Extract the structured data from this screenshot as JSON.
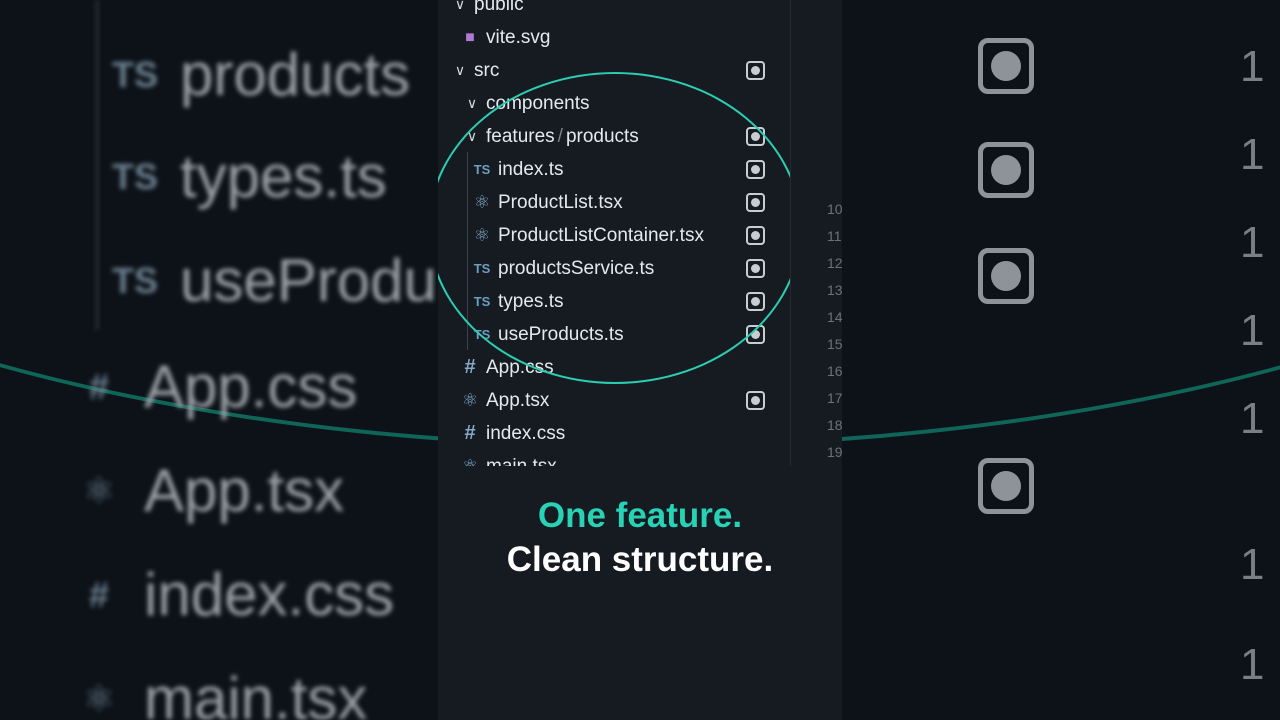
{
  "background": {
    "left_items": [
      {
        "icon": "TS",
        "text": "products"
      },
      {
        "icon": "TS",
        "text": "types.ts"
      },
      {
        "icon": "TS",
        "text": "useProdu"
      },
      {
        "icon": "#",
        "text": "App.css"
      },
      {
        "icon": "⚛",
        "text": "App.tsx"
      },
      {
        "icon": "#",
        "text": "index.css"
      },
      {
        "icon": "⚛",
        "text": "main.tsx"
      }
    ],
    "right_numbers": [
      "1",
      "1",
      "1",
      "1",
      "1",
      "1",
      "1"
    ]
  },
  "explorer": {
    "items": [
      {
        "chevron": "∨",
        "icon": "",
        "label": "public",
        "badge": false
      },
      {
        "chevron": "",
        "icon": "■",
        "label": "vite.svg",
        "badge": false
      },
      {
        "chevron": "∨",
        "icon": "",
        "label": "src",
        "badge": true
      },
      {
        "chevron": "∨",
        "icon": "",
        "label": "components",
        "badge": false
      },
      {
        "chevron": "∨",
        "icon": "",
        "label": "features",
        "label2": "products",
        "badge": true
      },
      {
        "chevron": "",
        "icon": "TS",
        "label": "index.ts",
        "badge": true
      },
      {
        "chevron": "",
        "icon": "⚛",
        "label": "ProductList.tsx",
        "badge": true
      },
      {
        "chevron": "",
        "icon": "⚛",
        "label": "ProductListContainer.tsx",
        "badge": true
      },
      {
        "chevron": "",
        "icon": "TS",
        "label": "productsService.ts",
        "badge": true
      },
      {
        "chevron": "",
        "icon": "TS",
        "label": "types.ts",
        "badge": true
      },
      {
        "chevron": "",
        "icon": "TS",
        "label": "useProducts.ts",
        "badge": true
      },
      {
        "chevron": "",
        "icon": "#",
        "label": "App.css",
        "badge": false
      },
      {
        "chevron": "",
        "icon": "⚛",
        "label": "App.tsx",
        "badge": true
      },
      {
        "chevron": "",
        "icon": "#",
        "label": "index.css",
        "badge": false
      },
      {
        "chevron": "",
        "icon": "⚛",
        "label": "main.tsx",
        "badge": false
      }
    ],
    "path_separator": "/"
  },
  "line_numbers": [
    "10",
    "11",
    "12",
    "13",
    "14",
    "15",
    "16",
    "17",
    "18",
    "19"
  ],
  "caption": {
    "line1": "One feature.",
    "line2": "Clean structure."
  },
  "colors": {
    "accent": "#28d2b5",
    "panel": "#161b22",
    "background": "#0b0f14"
  }
}
